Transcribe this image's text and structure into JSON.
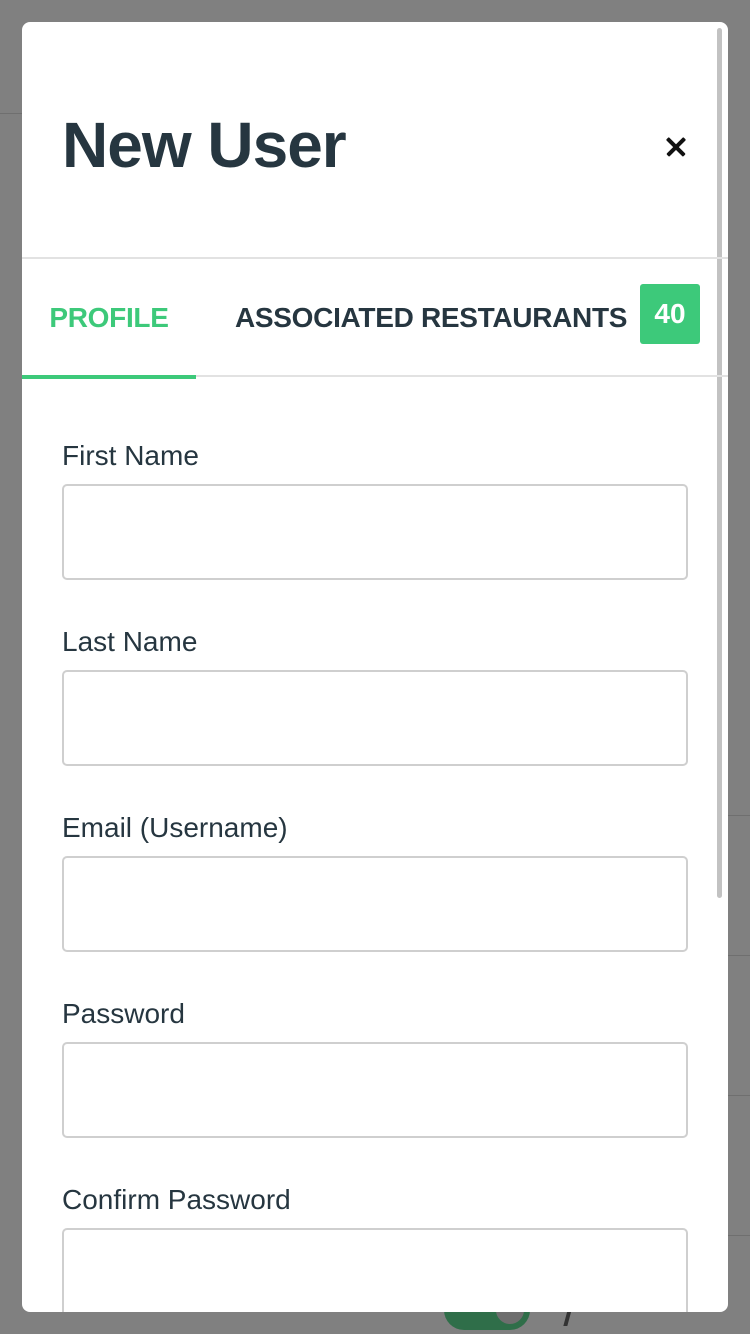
{
  "modal": {
    "title": "New User"
  },
  "tabs": [
    {
      "label": "PROFILE",
      "active": true
    },
    {
      "label": "ASSOCIATED RESTAURANTS",
      "active": false,
      "badge": "40"
    }
  ],
  "form": {
    "fields": [
      {
        "label": "First Name",
        "value": "",
        "placeholder": ""
      },
      {
        "label": "Last Name",
        "value": "",
        "placeholder": ""
      },
      {
        "label": "Email (Username)",
        "value": "",
        "placeholder": ""
      },
      {
        "label": "Password",
        "value": "",
        "placeholder": ""
      },
      {
        "label": "Confirm Password",
        "value": "",
        "placeholder": ""
      }
    ]
  },
  "colors": {
    "accent": "#3dc97a",
    "text": "#263640",
    "overlay": "#808080"
  },
  "icons": {
    "close": "close-icon"
  }
}
